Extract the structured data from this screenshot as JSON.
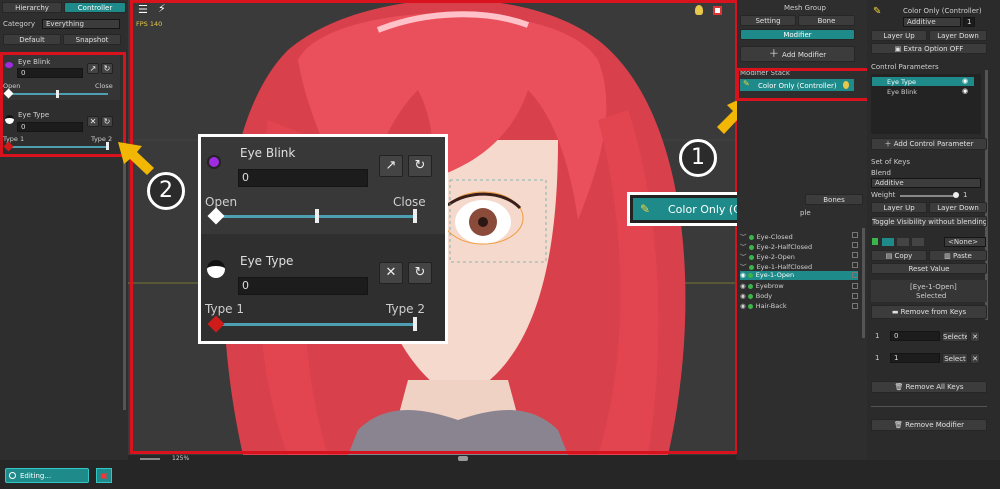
{
  "left": {
    "tabs": [
      "Hierarchy",
      "Controller"
    ],
    "category_label": "Category",
    "category_value": "Everything",
    "default_btn": "Default",
    "snapshot_btn": "Snapshot",
    "eye_blink": {
      "name": "Eye Blink",
      "value": "0",
      "min_label": "Open",
      "max_label": "Close",
      "level": 0.5
    },
    "eye_type": {
      "name": "Eye Type",
      "value": "0",
      "min_label": "Type 1",
      "max_label": "Type 2",
      "level": 0.0
    },
    "editing_btn": "Editing..."
  },
  "viewport": {
    "fps": "FPS 140",
    "zoom": "125%"
  },
  "callout": {
    "eye_blink": {
      "name": "Eye Blink",
      "value": "0",
      "min_label": "Open",
      "max_label": "Close"
    },
    "eye_type": {
      "name": "Eye Type",
      "value": "0",
      "min_label": "Type 1",
      "max_label": "Type 2"
    },
    "color_only": "Color Only (Controller)"
  },
  "badges": {
    "one": "1",
    "two": "2"
  },
  "mid_right": {
    "mesh_group": "Mesh Group",
    "setting_btn": "Setting",
    "bone_btn": "Bone",
    "modifier_btn": "Modifier",
    "add_modifier": "Add Modifier",
    "modifier_stack": "Modifier Stack",
    "modifier_item": "Color Only (Controller)",
    "tabs_partial": "ple",
    "bones_tab": "Bones",
    "tree": [
      {
        "label": "Eye-Closed",
        "selected": false
      },
      {
        "label": "Eye-2-HalfClosed",
        "selected": false
      },
      {
        "label": "Eye-2-Open",
        "selected": false
      },
      {
        "label": "Eye-1-HalfClosed",
        "selected": false
      },
      {
        "label": "Eye-1-Open",
        "selected": true
      },
      {
        "label": "Eyebrow",
        "selected": false
      },
      {
        "label": "Body",
        "selected": false
      },
      {
        "label": "Hair-Back",
        "selected": false
      }
    ]
  },
  "right": {
    "title": "Color Only (Controller)",
    "blend_mode": "Additive",
    "blend_num": "1",
    "layer_up": "Layer Up",
    "layer_down": "Layer Down",
    "extra_option": "Extra Option OFF",
    "control_params_label": "Control Parameters",
    "params": [
      "Eye Type",
      "Eye Blink"
    ],
    "add_control_param": "Add Control Parameter",
    "set_of_keys": "Set of Keys",
    "blend_label": "Blend",
    "blend_value": "Additive",
    "weight_label": "Weight",
    "weight_value": "1",
    "layer_up2": "Layer Up",
    "layer_down2": "Layer Down",
    "toggle_visibility": "Toggle Visibility without blending",
    "none_option": "<None>",
    "copy_btn": "Copy",
    "paste_btn": "Paste",
    "reset_value": "Reset Value",
    "selected_key": "[Eye-1-Open]",
    "selected_label": "Selected",
    "remove_from_keys": "Remove from Keys",
    "row1_idx": "1",
    "row1_val": "0",
    "row1_btn": "Selecte",
    "row2_idx": "1",
    "row2_val": "1",
    "row2_btn": "Select",
    "remove_all_keys": "Remove All Keys",
    "remove_modifier": "Remove Modifier"
  },
  "colors": {
    "accent": "#1e8a8a",
    "highlight": "#d9131e",
    "arrow": "#f2b705"
  }
}
